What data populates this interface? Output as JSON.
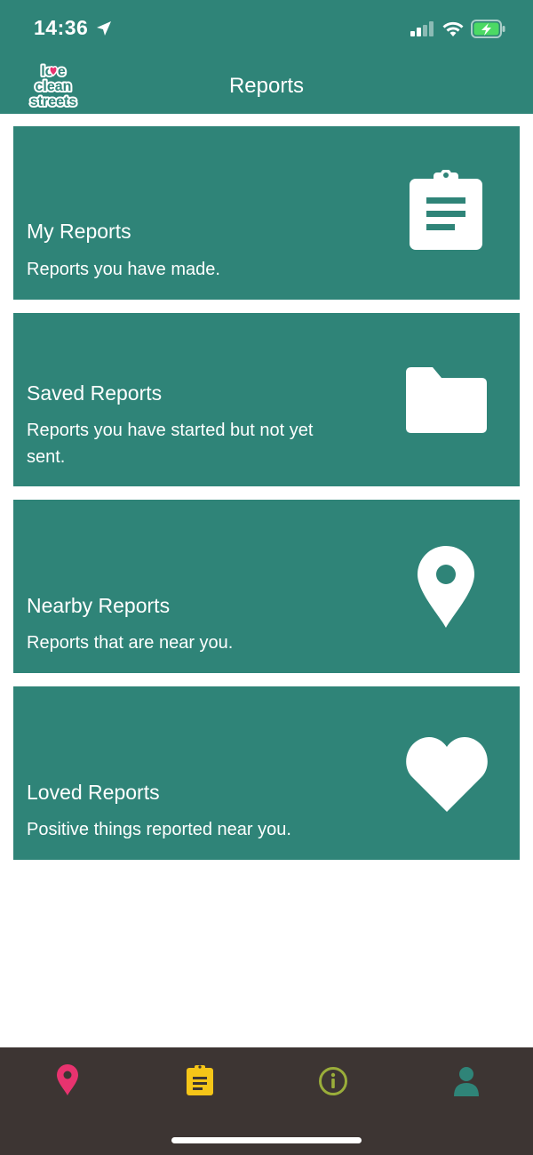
{
  "status_bar": {
    "time": "14:36"
  },
  "header": {
    "logo_text": [
      "love",
      "clean",
      "streets"
    ],
    "title": "Reports"
  },
  "cards": [
    {
      "title": "My Reports",
      "subtitle": "Reports you have made.",
      "icon": "clipboard-icon"
    },
    {
      "title": "Saved Reports",
      "subtitle": "Reports you have started but not yet sent.",
      "icon": "folder-icon"
    },
    {
      "title": "Nearby Reports",
      "subtitle": "Reports that are near you.",
      "icon": "map-pin-icon"
    },
    {
      "title": "Loved Reports",
      "subtitle": "Positive things reported near you.",
      "icon": "heart-icon"
    }
  ],
  "tab_bar": {
    "tabs": [
      {
        "icon": "map-pin-icon",
        "color": "#e8336f"
      },
      {
        "icon": "clipboard-icon",
        "color": "#f5c518",
        "active": true
      },
      {
        "icon": "info-icon",
        "color": "#9aad3a"
      },
      {
        "icon": "user-icon",
        "color": "#2f8478"
      }
    ]
  },
  "colors": {
    "brand_teal": "#2f8478",
    "tab_bar_bg": "#3d3533",
    "logo_pink": "#e8336f",
    "battery_green": "#4cd964"
  }
}
